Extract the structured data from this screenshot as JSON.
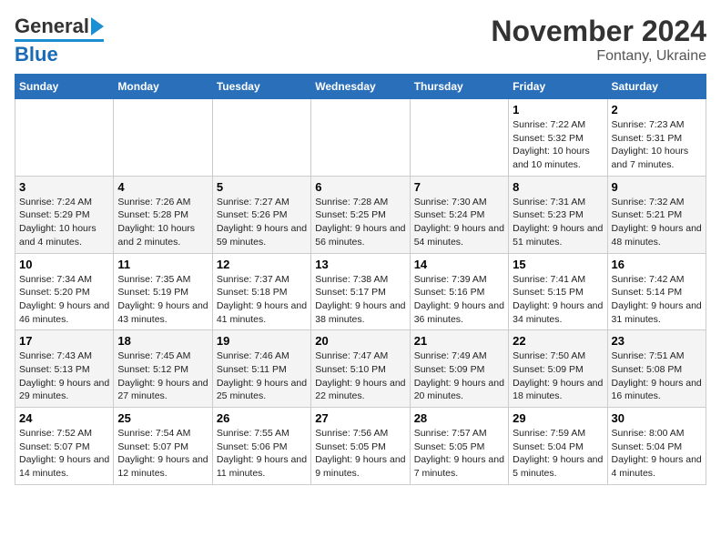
{
  "logo": {
    "text1": "General",
    "text2": "Blue"
  },
  "title": "November 2024",
  "subtitle": "Fontany, Ukraine",
  "days_of_week": [
    "Sunday",
    "Monday",
    "Tuesday",
    "Wednesday",
    "Thursday",
    "Friday",
    "Saturday"
  ],
  "weeks": [
    [
      {
        "day": "",
        "info": ""
      },
      {
        "day": "",
        "info": ""
      },
      {
        "day": "",
        "info": ""
      },
      {
        "day": "",
        "info": ""
      },
      {
        "day": "",
        "info": ""
      },
      {
        "day": "1",
        "info": "Sunrise: 7:22 AM\nSunset: 5:32 PM\nDaylight: 10 hours and 10 minutes."
      },
      {
        "day": "2",
        "info": "Sunrise: 7:23 AM\nSunset: 5:31 PM\nDaylight: 10 hours and 7 minutes."
      }
    ],
    [
      {
        "day": "3",
        "info": "Sunrise: 7:24 AM\nSunset: 5:29 PM\nDaylight: 10 hours and 4 minutes."
      },
      {
        "day": "4",
        "info": "Sunrise: 7:26 AM\nSunset: 5:28 PM\nDaylight: 10 hours and 2 minutes."
      },
      {
        "day": "5",
        "info": "Sunrise: 7:27 AM\nSunset: 5:26 PM\nDaylight: 9 hours and 59 minutes."
      },
      {
        "day": "6",
        "info": "Sunrise: 7:28 AM\nSunset: 5:25 PM\nDaylight: 9 hours and 56 minutes."
      },
      {
        "day": "7",
        "info": "Sunrise: 7:30 AM\nSunset: 5:24 PM\nDaylight: 9 hours and 54 minutes."
      },
      {
        "day": "8",
        "info": "Sunrise: 7:31 AM\nSunset: 5:23 PM\nDaylight: 9 hours and 51 minutes."
      },
      {
        "day": "9",
        "info": "Sunrise: 7:32 AM\nSunset: 5:21 PM\nDaylight: 9 hours and 48 minutes."
      }
    ],
    [
      {
        "day": "10",
        "info": "Sunrise: 7:34 AM\nSunset: 5:20 PM\nDaylight: 9 hours and 46 minutes."
      },
      {
        "day": "11",
        "info": "Sunrise: 7:35 AM\nSunset: 5:19 PM\nDaylight: 9 hours and 43 minutes."
      },
      {
        "day": "12",
        "info": "Sunrise: 7:37 AM\nSunset: 5:18 PM\nDaylight: 9 hours and 41 minutes."
      },
      {
        "day": "13",
        "info": "Sunrise: 7:38 AM\nSunset: 5:17 PM\nDaylight: 9 hours and 38 minutes."
      },
      {
        "day": "14",
        "info": "Sunrise: 7:39 AM\nSunset: 5:16 PM\nDaylight: 9 hours and 36 minutes."
      },
      {
        "day": "15",
        "info": "Sunrise: 7:41 AM\nSunset: 5:15 PM\nDaylight: 9 hours and 34 minutes."
      },
      {
        "day": "16",
        "info": "Sunrise: 7:42 AM\nSunset: 5:14 PM\nDaylight: 9 hours and 31 minutes."
      }
    ],
    [
      {
        "day": "17",
        "info": "Sunrise: 7:43 AM\nSunset: 5:13 PM\nDaylight: 9 hours and 29 minutes."
      },
      {
        "day": "18",
        "info": "Sunrise: 7:45 AM\nSunset: 5:12 PM\nDaylight: 9 hours and 27 minutes."
      },
      {
        "day": "19",
        "info": "Sunrise: 7:46 AM\nSunset: 5:11 PM\nDaylight: 9 hours and 25 minutes."
      },
      {
        "day": "20",
        "info": "Sunrise: 7:47 AM\nSunset: 5:10 PM\nDaylight: 9 hours and 22 minutes."
      },
      {
        "day": "21",
        "info": "Sunrise: 7:49 AM\nSunset: 5:09 PM\nDaylight: 9 hours and 20 minutes."
      },
      {
        "day": "22",
        "info": "Sunrise: 7:50 AM\nSunset: 5:09 PM\nDaylight: 9 hours and 18 minutes."
      },
      {
        "day": "23",
        "info": "Sunrise: 7:51 AM\nSunset: 5:08 PM\nDaylight: 9 hours and 16 minutes."
      }
    ],
    [
      {
        "day": "24",
        "info": "Sunrise: 7:52 AM\nSunset: 5:07 PM\nDaylight: 9 hours and 14 minutes."
      },
      {
        "day": "25",
        "info": "Sunrise: 7:54 AM\nSunset: 5:07 PM\nDaylight: 9 hours and 12 minutes."
      },
      {
        "day": "26",
        "info": "Sunrise: 7:55 AM\nSunset: 5:06 PM\nDaylight: 9 hours and 11 minutes."
      },
      {
        "day": "27",
        "info": "Sunrise: 7:56 AM\nSunset: 5:05 PM\nDaylight: 9 hours and 9 minutes."
      },
      {
        "day": "28",
        "info": "Sunrise: 7:57 AM\nSunset: 5:05 PM\nDaylight: 9 hours and 7 minutes."
      },
      {
        "day": "29",
        "info": "Sunrise: 7:59 AM\nSunset: 5:04 PM\nDaylight: 9 hours and 5 minutes."
      },
      {
        "day": "30",
        "info": "Sunrise: 8:00 AM\nSunset: 5:04 PM\nDaylight: 9 hours and 4 minutes."
      }
    ]
  ]
}
